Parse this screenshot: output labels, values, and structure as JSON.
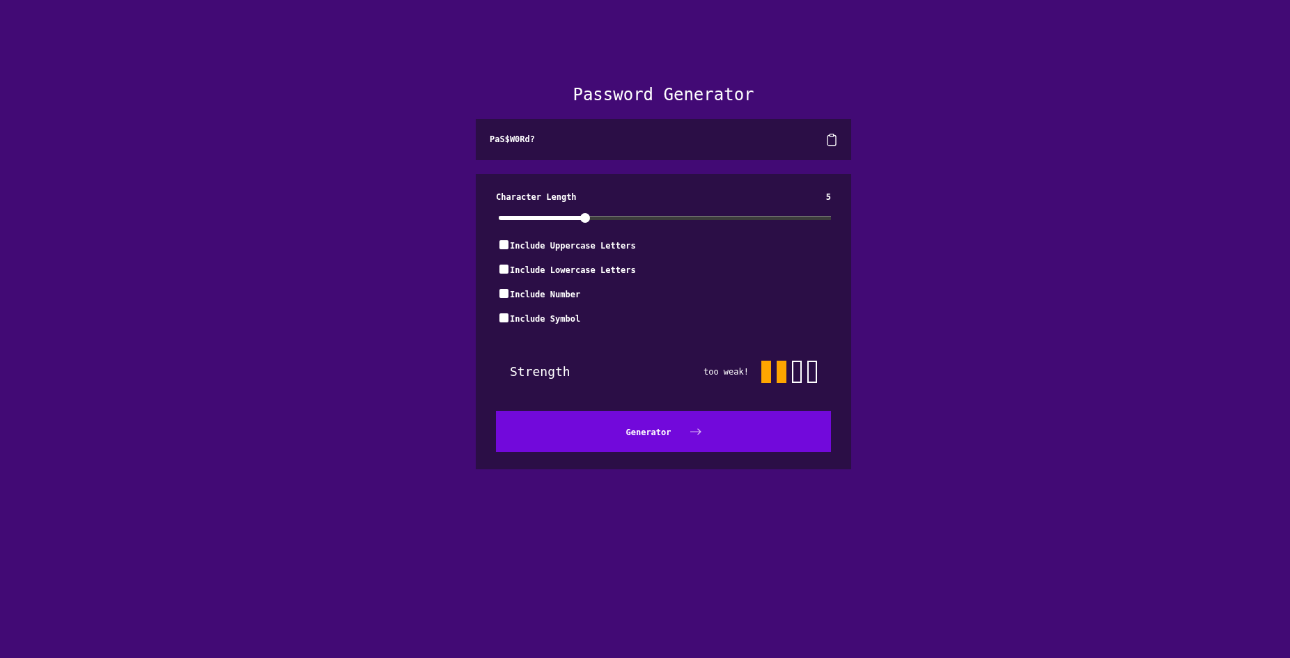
{
  "title": "Password Generator",
  "password": {
    "value": "PaS$W0Rd?"
  },
  "settings": {
    "length": {
      "label": "Character Length",
      "value": "5",
      "level": 0.26
    },
    "options": [
      {
        "label": "Include Uppercase Letters",
        "checked": false
      },
      {
        "label": "Include Lowercase Letters",
        "checked": false
      },
      {
        "label": "Include Number",
        "checked": false
      },
      {
        "label": "Include Symbol",
        "checked": false
      }
    ],
    "strength": {
      "label": "Strength",
      "rating": "too weak!",
      "bars": [
        {
          "filled": true
        },
        {
          "filled": true
        },
        {
          "filled": false
        },
        {
          "filled": false
        }
      ]
    },
    "button": {
      "label": "Generator"
    }
  }
}
